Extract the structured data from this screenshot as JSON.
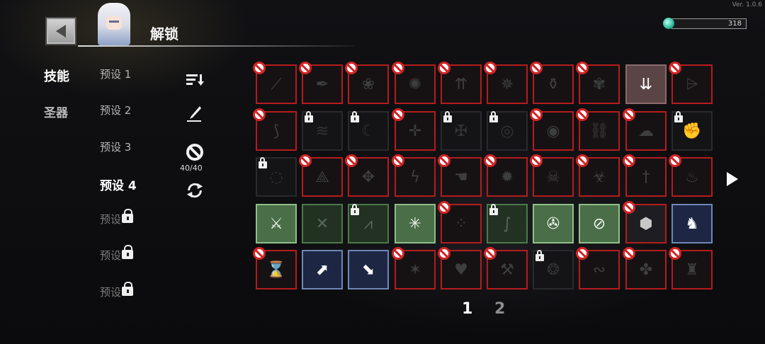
{
  "version": "Ver. 1.0.6",
  "header": {
    "title": "解锁",
    "gem_count": "318"
  },
  "tabs": {
    "skill": "技能",
    "relic": "圣器"
  },
  "presets": [
    {
      "label": "预设 1",
      "state": "normal"
    },
    {
      "label": "预设 2",
      "state": "normal"
    },
    {
      "label": "预设 3",
      "state": "normal"
    },
    {
      "label": "预设 4",
      "state": "active"
    },
    {
      "label": "预设",
      "state": "locked"
    },
    {
      "label": "预设",
      "state": "locked"
    },
    {
      "label": "预设",
      "state": "locked"
    }
  ],
  "tools": {
    "ban_count": "40/40"
  },
  "pagination": {
    "pages": [
      "1",
      "2"
    ],
    "current": "1"
  },
  "grid": [
    [
      {
        "icon": "slash-icon",
        "style": "banned"
      },
      {
        "icon": "feather-icon",
        "style": "banned"
      },
      {
        "icon": "rose-icon",
        "style": "banned"
      },
      {
        "icon": "burst-icon",
        "style": "banned"
      },
      {
        "icon": "arrow-split-icon",
        "style": "banned"
      },
      {
        "icon": "orb-sigil-icon",
        "style": "banned"
      },
      {
        "icon": "potion-icon",
        "style": "banned"
      },
      {
        "icon": "thorn-ring-icon",
        "style": "banned"
      },
      {
        "icon": "triple-arrow-icon",
        "style": "pink"
      },
      {
        "icon": "bat-icon",
        "style": "banned"
      }
    ],
    [
      {
        "icon": "claw-icon",
        "style": "banned"
      },
      {
        "icon": "shards-icon",
        "style": "locked"
      },
      {
        "icon": "crescent-icon",
        "style": "locked"
      },
      {
        "icon": "crosshair-icon",
        "style": "banned"
      },
      {
        "icon": "frost-sword-icon",
        "style": "locked"
      },
      {
        "icon": "vortex-icon",
        "style": "locked"
      },
      {
        "icon": "target-icon",
        "style": "banned"
      },
      {
        "icon": "chain-icon",
        "style": "banned"
      },
      {
        "icon": "cloud-icon",
        "style": "banned"
      },
      {
        "icon": "gauntlet-icon",
        "style": "locked"
      }
    ],
    [
      {
        "icon": "eye-icon",
        "style": "locked"
      },
      {
        "icon": "spike-icon",
        "style": "banned"
      },
      {
        "icon": "thorns-icon",
        "style": "banned"
      },
      {
        "icon": "lightning-icon",
        "style": "banned"
      },
      {
        "icon": "hand-icon",
        "style": "banned"
      },
      {
        "icon": "flame-ring-icon",
        "style": "banned"
      },
      {
        "icon": "skull-icon",
        "style": "banned"
      },
      {
        "icon": "biohazard-icon",
        "style": "banned"
      },
      {
        "icon": "sword-icon",
        "style": "banned"
      },
      {
        "icon": "fire-bomb-icon",
        "style": "banned"
      }
    ],
    [
      {
        "icon": "scythe-icon",
        "style": "green-on"
      },
      {
        "icon": "dagger-cross-icon",
        "style": "green-dim"
      },
      {
        "icon": "wing-icon",
        "style": "green-dim-locked"
      },
      {
        "icon": "crack-icon",
        "style": "green-on"
      },
      {
        "icon": "scatter-icon",
        "style": "banned"
      },
      {
        "icon": "whip-icon",
        "style": "green-dim-locked"
      },
      {
        "icon": "triskelion-icon",
        "style": "green-on"
      },
      {
        "icon": "no-entry-icon",
        "style": "green-on"
      },
      {
        "icon": "armor-icon",
        "style": "dark-banned"
      },
      {
        "icon": "ghost-icon",
        "style": "blue"
      }
    ],
    [
      {
        "icon": "hourglass-icon",
        "style": "banned-lit"
      },
      {
        "icon": "boot-up-icon",
        "style": "blue"
      },
      {
        "icon": "boot-strike-icon",
        "style": "blue"
      },
      {
        "icon": "spider-icon",
        "style": "banned"
      },
      {
        "icon": "heart-icon",
        "style": "banned"
      },
      {
        "icon": "sword-cross-icon",
        "style": "banned"
      },
      {
        "icon": "rune-icon",
        "style": "locked"
      },
      {
        "icon": "rat-icon",
        "style": "banned"
      },
      {
        "icon": "wolf-icon",
        "style": "banned"
      },
      {
        "icon": "dragon-icon",
        "style": "banned"
      }
    ]
  ],
  "glyphs": {
    "slash-icon": "⟋",
    "feather-icon": "✒",
    "rose-icon": "❀",
    "burst-icon": "✺",
    "arrow-split-icon": "⇈",
    "orb-sigil-icon": "✵",
    "potion-icon": "⚱",
    "thorn-ring-icon": "✾",
    "triple-arrow-icon": "⇊",
    "bat-icon": "⩥",
    "claw-icon": "⟆",
    "shards-icon": "≋",
    "crescent-icon": "☾",
    "crosshair-icon": "✛",
    "frost-sword-icon": "✠",
    "vortex-icon": "◎",
    "target-icon": "◉",
    "chain-icon": "⛓",
    "cloud-icon": "☁",
    "gauntlet-icon": "✊",
    "eye-icon": "◌",
    "spike-icon": "⟁",
    "thorns-icon": "✥",
    "lightning-icon": "ϟ",
    "hand-icon": "☚",
    "flame-ring-icon": "✹",
    "skull-icon": "☠",
    "biohazard-icon": "☣",
    "sword-icon": "†",
    "fire-bomb-icon": "♨",
    "scythe-icon": "⚔",
    "dagger-cross-icon": "✕",
    "wing-icon": "⩘",
    "crack-icon": "✳",
    "scatter-icon": "⁘",
    "whip-icon": "∫",
    "triskelion-icon": "✇",
    "no-entry-icon": "⊘",
    "armor-icon": "⬢",
    "ghost-icon": "♞",
    "hourglass-icon": "⌛",
    "boot-up-icon": "⬈",
    "boot-strike-icon": "⬊",
    "spider-icon": "✶",
    "heart-icon": "♥",
    "sword-cross-icon": "⚒",
    "rune-icon": "❂",
    "rat-icon": "∾",
    "wolf-icon": "✤",
    "dragon-icon": "♜"
  }
}
